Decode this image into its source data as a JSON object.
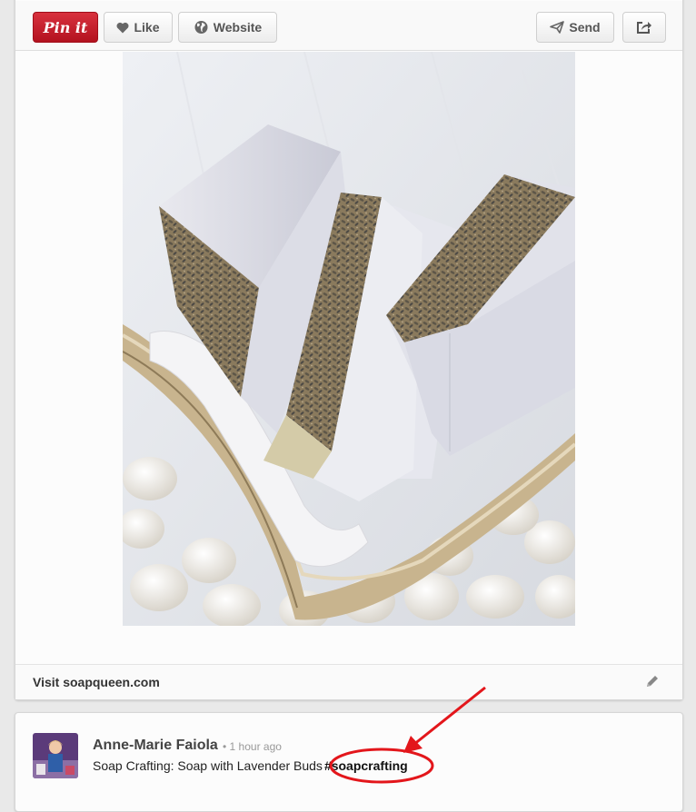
{
  "toolbar": {
    "pin_label": "Pin it",
    "like_label": "Like",
    "website_label": "Website",
    "send_label": "Send"
  },
  "pin": {
    "visit_label": "Visit soapqueen.com"
  },
  "comment": {
    "author": "Anne-Marie Faiola",
    "time": "• 1 hour ago",
    "text": "Soap Crafting: Soap with Lavender Buds",
    "hashtag": "#soapcrafting"
  },
  "colors": {
    "pin_red": "#c8232c",
    "annotation_red": "#e3161b"
  },
  "icons": [
    "heart-icon",
    "globe-icon",
    "send-icon",
    "share-icon",
    "pencil-icon"
  ]
}
